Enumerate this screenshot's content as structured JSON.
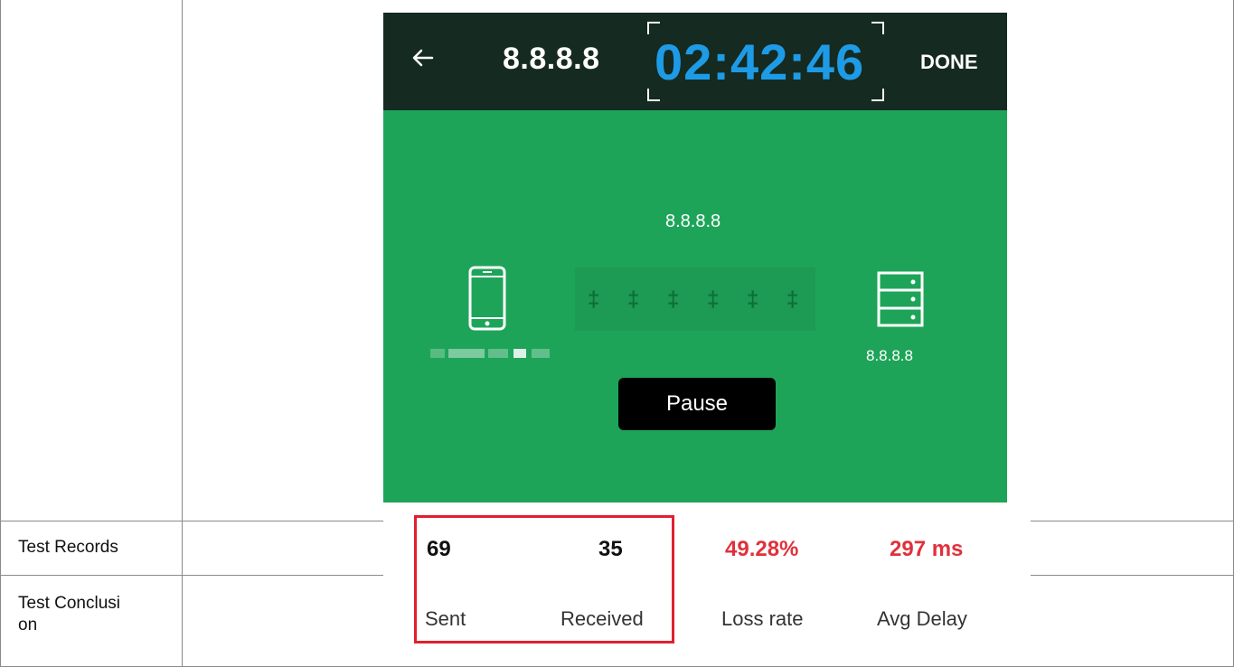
{
  "table": {
    "rows": [
      {
        "label": "Test Records"
      },
      {
        "label": "Test Conclusi\non"
      }
    ]
  },
  "phone": {
    "top_bar": {
      "back_icon": "arrow-left-icon",
      "ip": "8.8.8.8",
      "timer": "02:42:46",
      "done_label": "DONE"
    },
    "diagram": {
      "center_ip": "8.8.8.8",
      "server_ip": "8.8.8.8",
      "device_icon": "smartphone-icon",
      "server_icon": "server-icon",
      "packet_icon": "packet-icon",
      "packet_count": 6,
      "pause_label": "Pause"
    },
    "stats": [
      {
        "value": "69",
        "label": "Sent",
        "value_color": "#111111"
      },
      {
        "value": "35",
        "label": "Received",
        "value_color": "#111111"
      },
      {
        "value": "49.28%",
        "label": "Loss rate",
        "value_color": "#e0313c"
      },
      {
        "value": "297 ms",
        "label": "Avg Delay",
        "value_color": "#e0313c"
      }
    ]
  },
  "colors": {
    "top_bar": "#152a20",
    "green": "#1ea459",
    "timer": "#1e9be6",
    "highlight": "#e0202e"
  }
}
